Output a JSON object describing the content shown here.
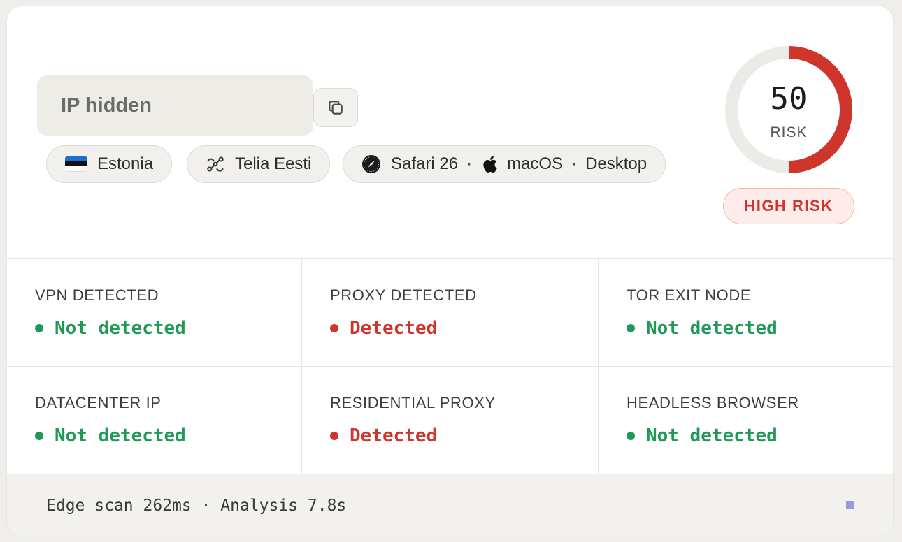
{
  "ip": {
    "value": "IP hidden"
  },
  "chips": {
    "country": "Estonia",
    "isp": "Telia Eesti",
    "browser": "Safari 26",
    "os": "macOS",
    "device": "Desktop",
    "separator": "·"
  },
  "risk": {
    "score": "50",
    "score_value": 50,
    "score_max": 100,
    "label": "RISK",
    "level": "HIGH RISK",
    "color": "#d0352c"
  },
  "checks": [
    {
      "title": "VPN DETECTED",
      "status": "Not detected",
      "detected": false
    },
    {
      "title": "PROXY DETECTED",
      "status": "Detected",
      "detected": true
    },
    {
      "title": "TOR EXIT NODE",
      "status": "Not detected",
      "detected": false
    },
    {
      "title": "DATACENTER IP",
      "status": "Not detected",
      "detected": false
    },
    {
      "title": "RESIDENTIAL PROXY",
      "status": "Detected",
      "detected": true
    },
    {
      "title": "HEADLESS BROWSER",
      "status": "Not detected",
      "detected": false
    }
  ],
  "footer": {
    "text": "Edge scan 262ms · Analysis 7.8s"
  },
  "colors": {
    "ok": "#1f9a55",
    "bad": "#d0352c",
    "accent": "#9b9be0"
  },
  "icons": {
    "copy": "copy-icon",
    "flag": "estonia-flag-icon",
    "isp": "network-route-icon",
    "browser": "safari-compass-icon",
    "os": "apple-logo-icon"
  }
}
